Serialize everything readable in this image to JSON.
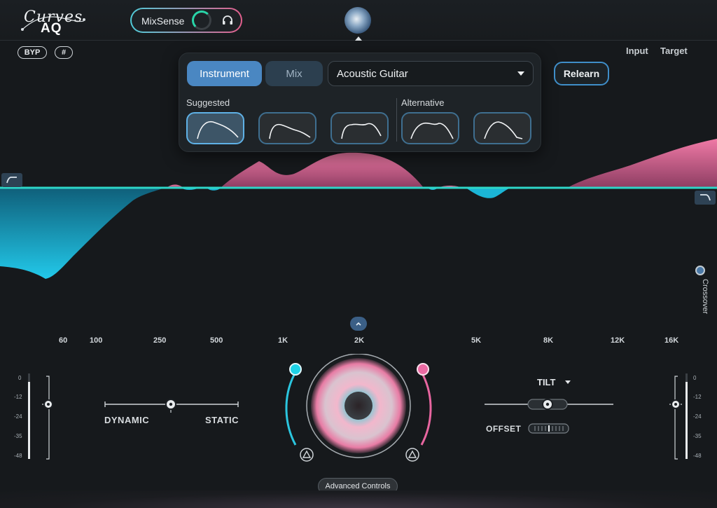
{
  "app": {
    "logo_line1": "Curves",
    "logo_line2": "AQ"
  },
  "header": {
    "mixsense_label": "MixSense",
    "bypass_label": "BYP",
    "grid_label": "#",
    "input_label": "Input",
    "target_label": "Target"
  },
  "panel": {
    "tabs": [
      {
        "label": "Instrument",
        "active": true
      },
      {
        "label": "Mix",
        "active": false
      }
    ],
    "source_value": "Acoustic Guitar",
    "suggested_label": "Suggested",
    "alternative_label": "Alternative",
    "relearn_label": "Relearn"
  },
  "curve": {
    "crossover_label": "Crossover",
    "freq_labels": [
      "60",
      "100",
      "250",
      "500",
      "1K",
      "2K",
      "5K",
      "8K",
      "12K",
      "16K"
    ]
  },
  "meters": {
    "ticks": [
      "0",
      "-12",
      "-24",
      "-35",
      "-48"
    ]
  },
  "controls": {
    "dynamic_label": "DYNAMIC",
    "static_label": "STATIC",
    "tilt_label": "TILT",
    "offset_label": "OFFSET",
    "advanced_label": "Advanced Controls"
  },
  "colors": {
    "accent_blue": "#4a87c2",
    "cut_cyan": "#1fc7e6",
    "boost_pink": "#e8679a",
    "baseline": "#2dd6c8"
  }
}
